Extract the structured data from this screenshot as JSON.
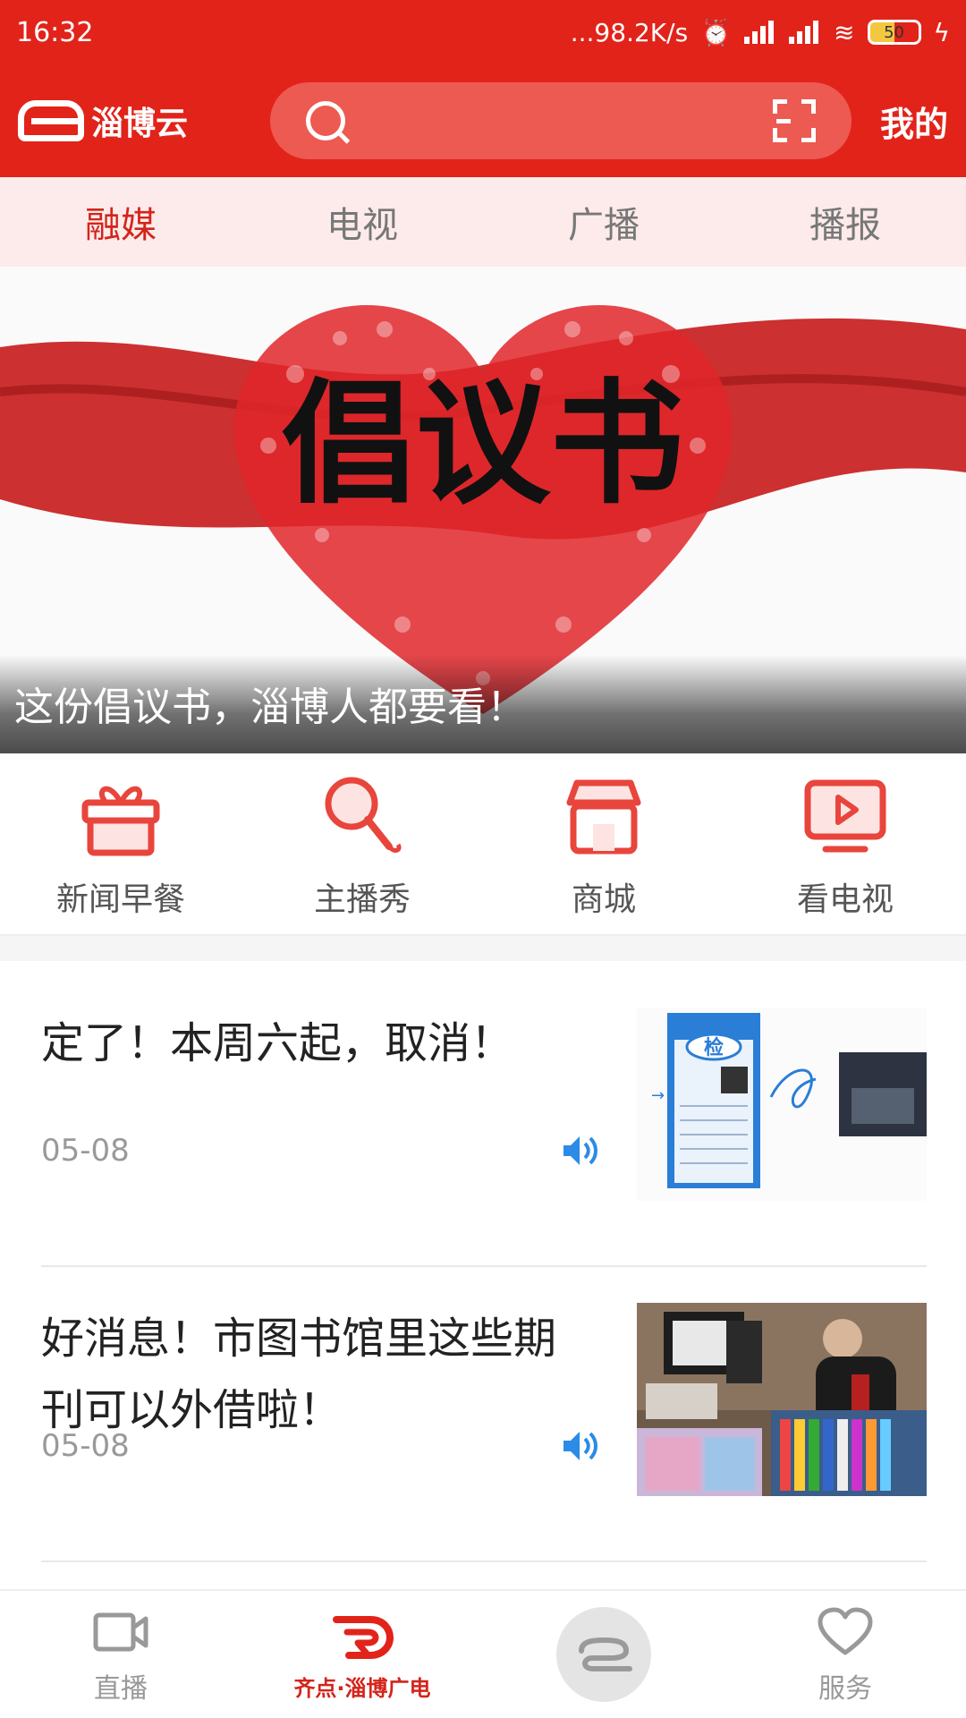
{
  "status_bar": {
    "time": "16:32",
    "network_speed": "...98.2K/s",
    "battery": "50"
  },
  "header": {
    "brand": "淄博云",
    "my_label": "我的",
    "search_placeholder": ""
  },
  "tabs": [
    {
      "label": "融媒",
      "active": true
    },
    {
      "label": "电视",
      "active": false
    },
    {
      "label": "广播",
      "active": false
    },
    {
      "label": "播报",
      "active": false
    }
  ],
  "banner": {
    "image_text": "倡议书",
    "caption": "这份倡议书，淄博人都要看！"
  },
  "quick_links": [
    {
      "label": "新闻早餐",
      "icon": "gift-icon"
    },
    {
      "label": "主播秀",
      "icon": "microphone-icon"
    },
    {
      "label": "商城",
      "icon": "store-icon"
    },
    {
      "label": "看电视",
      "icon": "tv-play-icon"
    }
  ],
  "news": [
    {
      "title": "定了！本周六起，取消！",
      "date": "05-08",
      "thumb_caption": "检"
    },
    {
      "title": "好消息！市图书馆里这些期刊可以外借啦！",
      "date": "05-08"
    }
  ],
  "bottom_nav": [
    {
      "label": "直播",
      "icon": "video-camera-icon",
      "active": false
    },
    {
      "label": "齐点·淄博广电",
      "icon": "qidian-logo-icon",
      "active": true
    },
    {
      "label": "",
      "icon": "zibo-cloud-logo-icon",
      "active": false
    },
    {
      "label": "服务",
      "icon": "heart-icon",
      "active": false
    }
  ],
  "colors": {
    "primary": "#e2231a",
    "tab_bg": "#fcebea",
    "accent_blue": "#2b8be6"
  }
}
